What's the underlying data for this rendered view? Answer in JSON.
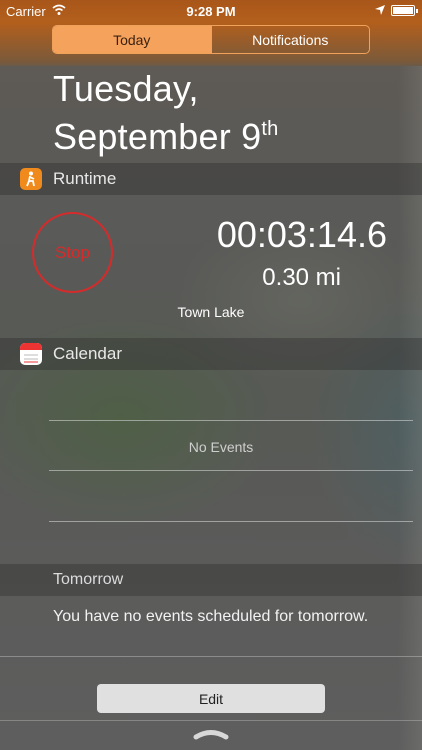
{
  "status_bar": {
    "carrier": "Carrier",
    "time": "9:28 PM"
  },
  "tabs": [
    {
      "label": "Today",
      "active": true
    },
    {
      "label": "Notifications",
      "active": false
    }
  ],
  "date": {
    "weekday": "Tuesday,",
    "month_day": "September 9",
    "ordinal": "th"
  },
  "runtime": {
    "title": "Runtime",
    "stop_label": "Stop",
    "elapsed": "00:03:14.6",
    "distance": "0.30 mi",
    "location": "Town Lake"
  },
  "calendar": {
    "title": "Calendar",
    "empty_text": "No Events"
  },
  "tomorrow": {
    "title": "Tomorrow",
    "message": "You have no events scheduled for tomorrow."
  },
  "footer": {
    "edit_label": "Edit"
  },
  "colors": {
    "accent_orange": "#f5a25c",
    "status_orange": "#b35f1c",
    "stop_red": "#d52b2b"
  }
}
